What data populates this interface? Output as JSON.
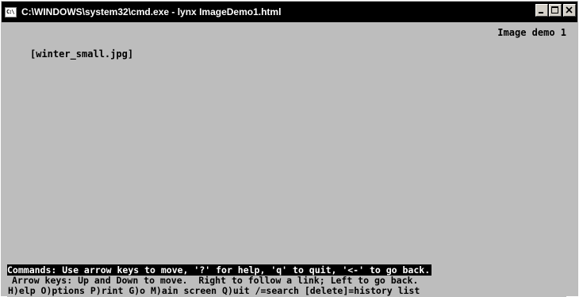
{
  "window": {
    "title": "C:\\WINDOWS\\system32\\cmd.exe - lynx ImageDemo1.html",
    "icon_label": "C:\\",
    "icon": "console-window-icon"
  },
  "caption_buttons": {
    "minimize": "minimize-icon",
    "maximize": "maximize-icon",
    "close": "close-icon"
  },
  "page": {
    "title": "Image demo 1",
    "image_link": "[winter_small.jpg]"
  },
  "status": {
    "text": "Commands: Use arrow keys to move, '?' for help, 'q' to quit, '<-' to go back."
  },
  "help": {
    "arrow_keys": "Arrow keys: Up and Down to move.  Right to follow a link; Left to go back.",
    "menu": "H)elp O)ptions P)rint G)o M)ain screen Q)uit /=search [delete]=history list"
  }
}
